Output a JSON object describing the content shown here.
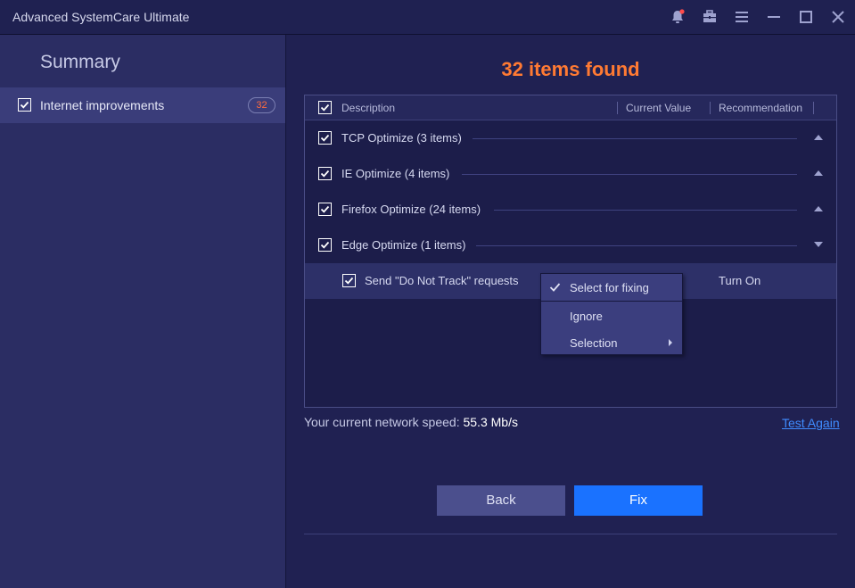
{
  "window": {
    "title": "Advanced SystemCare Ultimate"
  },
  "titlebar_icons": [
    "bell-icon",
    "toolbox-icon",
    "menu-icon",
    "minimize-icon",
    "maximize-icon",
    "close-icon"
  ],
  "sidebar": {
    "title": "Summary",
    "items": [
      {
        "label": "Internet improvements",
        "count": "32",
        "checked": true
      }
    ]
  },
  "main": {
    "headline": "32 items found",
    "table": {
      "columns": [
        "Description",
        "Current Value",
        "Recommendation"
      ],
      "groups": [
        {
          "label": "TCP Optimize (3 items)",
          "expanded": false
        },
        {
          "label": "IE Optimize (4 items)",
          "expanded": false
        },
        {
          "label": "Firefox Optimize (24 items)",
          "expanded": false
        },
        {
          "label": "Edge Optimize (1 items)",
          "expanded": true
        }
      ],
      "sub_rows": [
        {
          "label": "Send \"Do Not Track\" requests",
          "current": "",
          "recommendation": "Turn On"
        }
      ]
    },
    "context_menu": {
      "items": [
        {
          "label": "Select for fixing",
          "checked": true
        },
        {
          "label": "Ignore"
        },
        {
          "label": "Selection",
          "submenu": true
        }
      ]
    },
    "speed": {
      "label": "Your current network speed:",
      "value": "55.3 Mb/s"
    },
    "test_again": "Test Again",
    "buttons": {
      "back": "Back",
      "fix": "Fix"
    }
  },
  "colors": {
    "accent_orange": "#ff7a33",
    "accent_blue": "#1a72ff",
    "link_blue": "#3f8cff",
    "badge_orange": "#ff6b3d"
  }
}
